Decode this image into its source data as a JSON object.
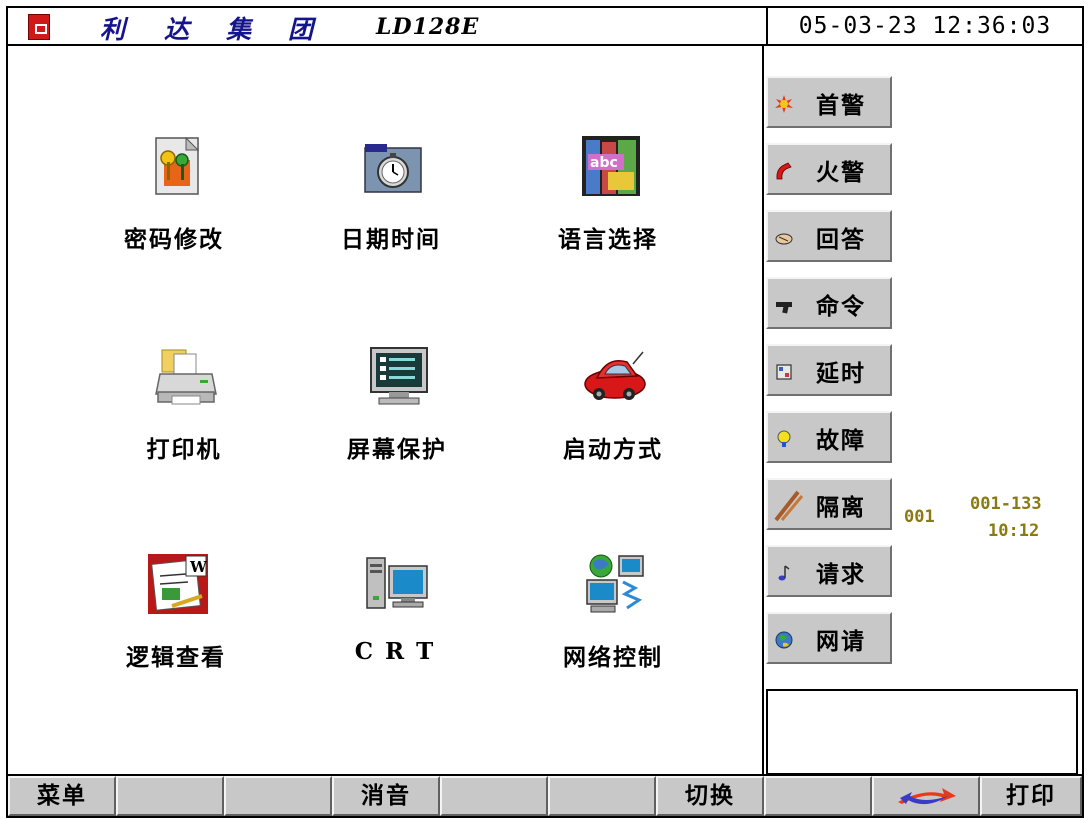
{
  "header": {
    "brand_chars": [
      "利",
      "达",
      "集",
      "团"
    ],
    "model": "LD128E",
    "datetime": "05-03-23 12:36:03"
  },
  "menu": {
    "items": [
      {
        "label": "密码修改",
        "icon": "keys-document-icon"
      },
      {
        "label": "日期时间",
        "icon": "stopwatch-folder-icon"
      },
      {
        "label": "语言选择",
        "icon": "abc-books-icon"
      },
      {
        "label": "打印机",
        "icon": "printer-icon"
      },
      {
        "label": "屏幕保护",
        "icon": "monitor-icon"
      },
      {
        "label": "启动方式",
        "icon": "red-car-icon"
      },
      {
        "label": "逻辑查看",
        "icon": "word-document-icon"
      },
      {
        "label": "C R T",
        "icon": "computer-icon"
      },
      {
        "label": "网络控制",
        "icon": "network-computers-icon"
      }
    ]
  },
  "side": {
    "buttons": [
      {
        "label": "首警",
        "icon": "first-alarm-icon"
      },
      {
        "label": "火警",
        "icon": "fire-alarm-icon"
      },
      {
        "label": "回答",
        "icon": "handshake-icon"
      },
      {
        "label": "命令",
        "icon": "pistol-icon"
      },
      {
        "label": "延时",
        "icon": "timer-icon"
      },
      {
        "label": "故障",
        "icon": "bulb-icon"
      },
      {
        "label": "隔离",
        "icon": "isolation-sticks-icon"
      },
      {
        "label": "请求",
        "icon": "music-note-icon"
      },
      {
        "label": "网请",
        "icon": "globe-people-icon"
      }
    ],
    "isolation": {
      "count": "001",
      "range": "001-133",
      "time": "10:12"
    }
  },
  "footer": {
    "keys": [
      "菜单",
      "",
      "",
      "消音",
      "",
      "",
      "切换",
      "",
      "",
      "打印"
    ]
  },
  "colors": {
    "brand_blue": "#14148c",
    "button_gray": "#c8c8c8",
    "status_olive": "#8a7a10"
  }
}
